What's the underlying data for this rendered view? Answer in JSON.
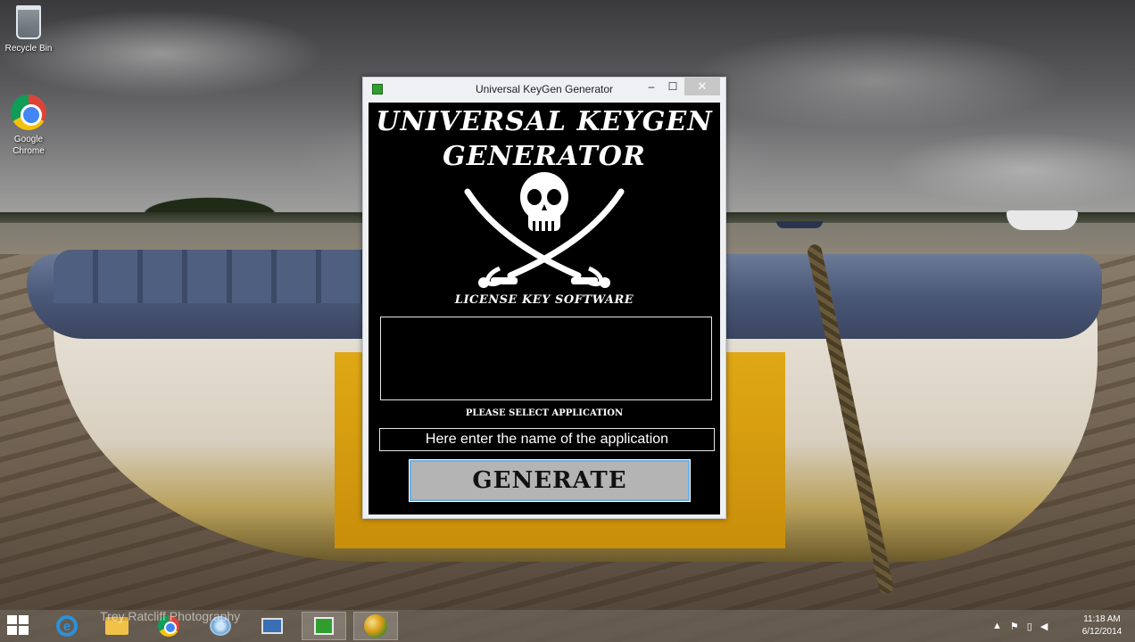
{
  "desktop": {
    "icons": [
      {
        "label": "Recycle Bin",
        "icon": "recycle-bin-icon"
      },
      {
        "label": "Google\nChrome",
        "icon": "chrome-icon"
      }
    ]
  },
  "window": {
    "title": "Universal KeyGen Generator",
    "controls": {
      "minimize": "–",
      "maximize": "☐",
      "close": "✕"
    },
    "headline_line1": "UNIVERSAL KEYGEN",
    "headline_line2": "GENERATOR",
    "logo_icon": "skull-crossed-swords-icon",
    "tagline": "LICENSE KEY SOFTWARE",
    "output_value": "",
    "select_label": "PLEASE SELECT APPLICATION",
    "app_input_value": "Here enter the name of the application",
    "generate_label": "GENERATE"
  },
  "taskbar": {
    "items": [
      "start-icon",
      "internet-explorer-icon",
      "file-explorer-icon",
      "chrome-icon",
      "network-icon",
      "remote-desktop-icon",
      "keygen-app-icon",
      "orb-app-icon"
    ],
    "watermark": "Trey Ratcliff Photography",
    "clock_time": "11:18 AM",
    "clock_date": "6/12/2014"
  },
  "colors": {
    "window_background": "#000000",
    "button_background": "#b4b4b4",
    "button_border": "#6ab0e8",
    "text": "#ffffff"
  }
}
